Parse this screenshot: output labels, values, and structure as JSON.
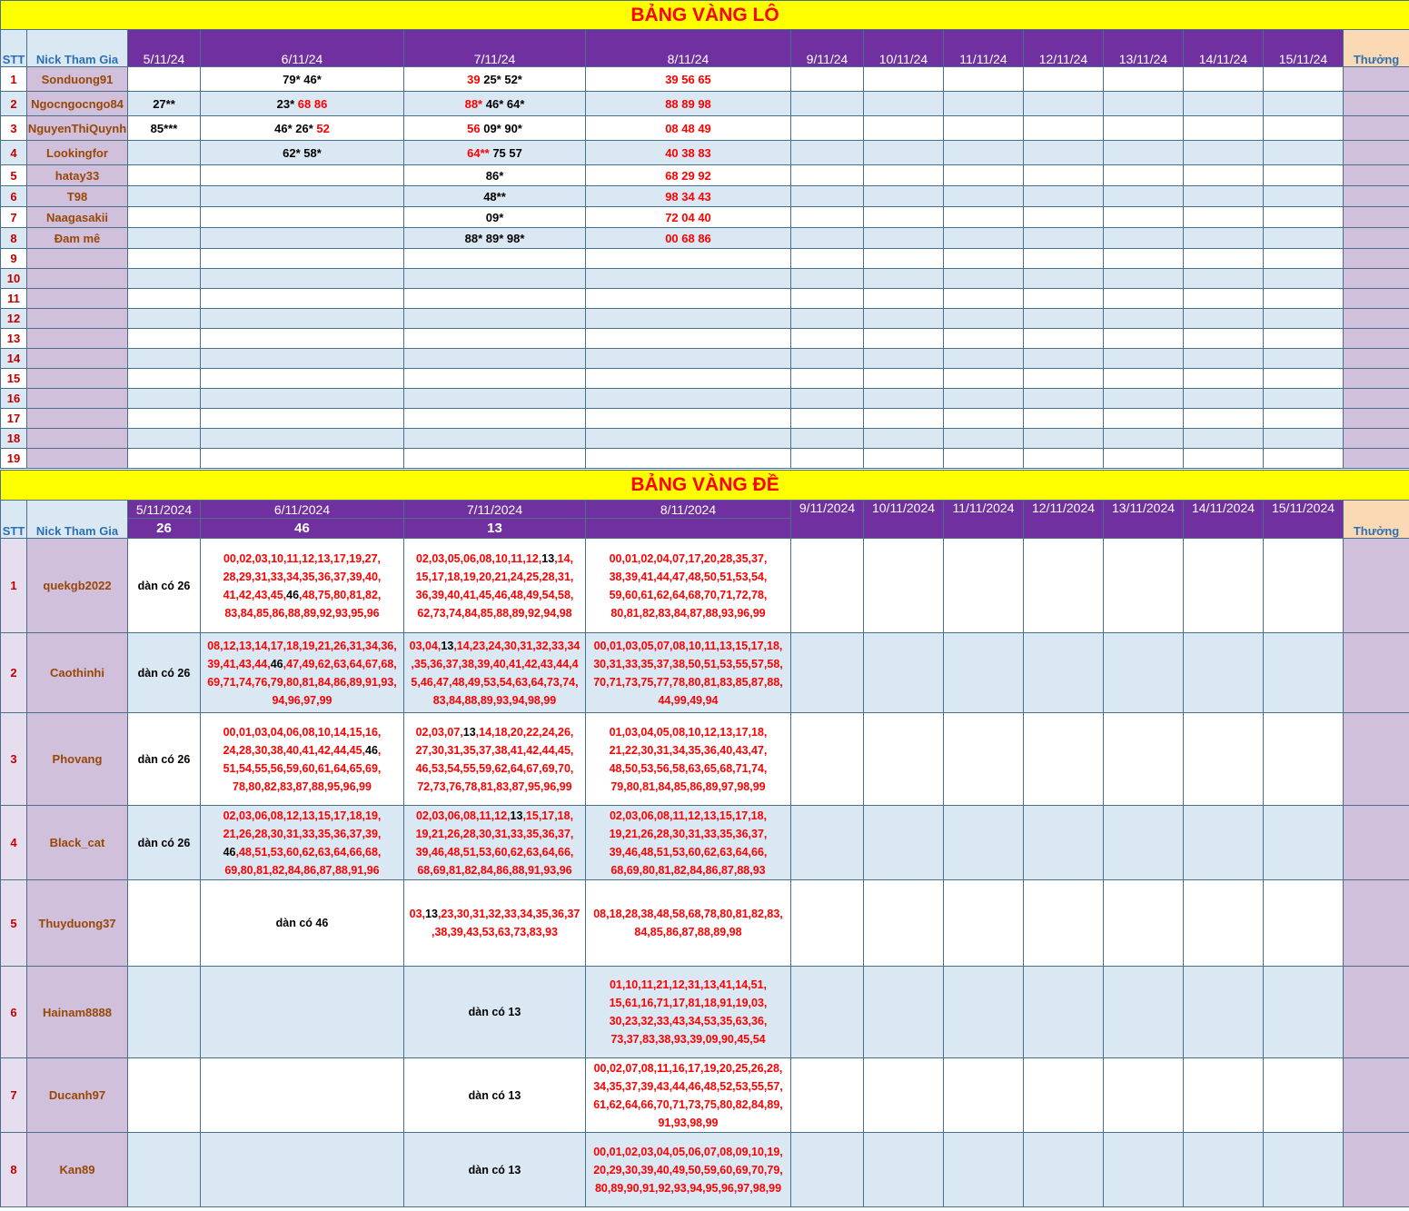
{
  "lo": {
    "title": "BẢNG VÀNG LÔ",
    "headers": {
      "stt": "STT",
      "nick": "Nick Tham Gia",
      "thuong": "Thưởng"
    },
    "dates": [
      "5/11/24",
      "6/11/24",
      "7/11/24",
      "8/11/24",
      "9/11/24",
      "10/11/24",
      "11/11/24",
      "12/11/24",
      "13/11/24",
      "14/11/24",
      "15/11/24"
    ],
    "rows": [
      {
        "stt": "1",
        "nick": "Sonduong91",
        "d1": "",
        "d2": "79* 46*",
        "d3": "39",
        "d3b": "25* 52*",
        "d4": "39 56 65"
      },
      {
        "stt": "2",
        "nick": "Ngocngocngo84",
        "d1": "27**",
        "d2": "23*",
        "d2b": "68 86",
        "d3": "88*",
        "d3b": "46* 64*",
        "d4": "88 89 98"
      },
      {
        "stt": "3",
        "nick": "NguyenThiQuynh",
        "d1": "85***",
        "d2": "46* 26*",
        "d2b": "52",
        "d3": "56",
        "d3b": "09* 90*",
        "d4": "08 48 49"
      },
      {
        "stt": "4",
        "nick": "Lookingfor",
        "d1": "",
        "d2": "62* 58*",
        "d3": "64**",
        "d3b": "75 57",
        "d4": "40 38 83"
      },
      {
        "stt": "5",
        "nick": "hatay33",
        "d1": "",
        "d2": "",
        "d3": "86*",
        "d4": "68 29 92"
      },
      {
        "stt": "6",
        "nick": "T98",
        "d1": "",
        "d2": "",
        "d3": "48**",
        "d4": "98 34 43"
      },
      {
        "stt": "7",
        "nick": "Naagasakii",
        "d1": "",
        "d2": "",
        "d3": "09*",
        "d4": "72 04 40"
      },
      {
        "stt": "8",
        "nick": "Đam mê",
        "d1": "",
        "d2": "",
        "d3": "88* 89* 98*",
        "d4": "00 68 86"
      }
    ],
    "empty_stt": [
      "9",
      "10",
      "11",
      "12",
      "13",
      "14",
      "15",
      "16",
      "17",
      "18",
      "19"
    ]
  },
  "de": {
    "title": "BẢNG VÀNG ĐỀ",
    "headers": {
      "stt": "STT",
      "nick": "Nick Tham Gia",
      "thuong": "Thưởng"
    },
    "dates": [
      "5/11/2024",
      "6/11/2024",
      "7/11/2024",
      "8/11/2024",
      "9/11/2024",
      "10/11/2024",
      "11/11/2024",
      "12/11/2024",
      "13/11/2024",
      "14/11/2024",
      "15/11/2024"
    ],
    "results": [
      "26",
      "46",
      "13"
    ],
    "rows": [
      {
        "stt": "1",
        "nick": "quekgb2022",
        "d1": "dàn có 26",
        "d2a": "00,02,03,10,11,12,13,17,19,27, 28,29,31,33,34,35,36,37,39,40, 41,42,43,45,",
        "d2b": "46",
        "d2c": ",48,75,80,81,82, 83,84,85,86,88,89,92,93,95,96",
        "d3a": "02,03,05,06,08,10,11,12,",
        "d3b": "13",
        "d3c": ",14, 15,17,18,19,20,21,24,25,28,31, 36,39,40,41,45,46,48,49,54,58, 62,73,74,84,85,88,89,92,94,98",
        "d4": "00,01,02,04,07,17,20,28,35,37, 38,39,41,44,47,48,50,51,53,54, 59,60,61,62,64,68,70,71,72,78, 80,81,82,83,84,87,88,93,96,99"
      },
      {
        "stt": "2",
        "nick": "Caothinhi",
        "d1": "dàn có 26",
        "d2a": "08,12,13,14,17,18,19,21,26,31,34,36, 39,41,43,44,",
        "d2b": "46",
        "d2c": ",47,49,62,63,64,67,68, 69,71,74,76,79,80,81,84,86,89,91,93, 94,96,97,99",
        "d3a": "03,04,",
        "d3b": "13",
        "d3c": ",14,23,24,30,31,32,33,34 ,35,36,37,38,39,40,41,42,43,44,4 5,46,47,48,49,53,54,63,64,73,74, 83,84,88,89,93,94,98,99",
        "d4": "00,01,03,05,07,08,10,11,13,15,17,18, 30,31,33,35,37,38,50,51,53,55,57,58, 70,71,73,75,77,78,80,81,83,85,87,88, 44,99,49,94"
      },
      {
        "stt": "3",
        "nick": "Phovang",
        "d1": "dàn có 26",
        "d2a": "00,01,03,04,06,08,10,14,15,16, 24,28,30,38,40,41,42,44,45,",
        "d2b": "46",
        "d2c": ", 51,54,55,56,59,60,61,64,65,69, 78,80,82,83,87,88,95,96,99",
        "d3a": "02,03,07,",
        "d3b": "13",
        "d3c": ",14,18,20,22,24,26, 27,30,31,35,37,38,41,42,44,45, 46,53,54,55,59,62,64,67,69,70, 72,73,76,78,81,83,87,95,96,99",
        "d4": "01,03,04,05,08,10,12,13,17,18, 21,22,30,31,34,35,36,40,43,47, 48,50,53,56,58,63,65,68,71,74, 79,80,81,84,85,86,89,97,98,99"
      },
      {
        "stt": "4",
        "nick": "Black_cat",
        "d1": "dàn có 26",
        "d2a": "02,03,06,08,12,13,15,17,18,19, 21,26,28,30,31,33,35,36,37,39, ",
        "d2b": "46",
        "d2c": ",48,51,53,60,62,63,64,66,68, 69,80,81,82,84,86,87,88,91,96",
        "d3a": "02,03,06,08,11,12,",
        "d3b": "13",
        "d3c": ",15,17,18, 19,21,26,28,30,31,33,35,36,37, 39,46,48,51,53,60,62,63,64,66, 68,69,81,82,84,86,88,91,93,96",
        "d4": "02,03,06,08,11,12,13,15,17,18, 19,21,26,28,30,31,33,35,36,37, 39,46,48,51,53,60,62,63,64,66, 68,69,80,81,82,84,86,87,88,93"
      },
      {
        "stt": "5",
        "nick": "Thuyduong37",
        "d1": "",
        "d2a": "",
        "d2b": "dàn có 46",
        "d2c": "",
        "d3a": "03,",
        "d3b": "13",
        "d3c": ",23,30,31,32,33,34,35,36,37 ,38,39,43,53,63,73,83,93",
        "d4": "08,18,28,38,48,58,68,78,80,81,82,83, 84,85,86,87,88,89,98"
      },
      {
        "stt": "6",
        "nick": "Hainam8888",
        "d1": "",
        "d2a": "",
        "d2b": "",
        "d2c": "",
        "d3a": "",
        "d3b": "dàn có 13",
        "d3c": "",
        "d4": "01,10,11,21,12,31,13,41,14,51, 15,61,16,71,17,81,18,91,19,03, 30,23,32,33,43,34,53,35,63,36, 73,37,83,38,93,39,09,90,45,54"
      },
      {
        "stt": "7",
        "nick": "Ducanh97",
        "d1": "",
        "d2a": "",
        "d2b": "",
        "d2c": "",
        "d3a": "",
        "d3b": "dàn có 13",
        "d3c": "",
        "d4": "00,02,07,08,11,16,17,19,20,25,26,28, 34,35,37,39,43,44,46,48,52,53,55,57, 61,62,64,66,70,71,73,75,80,82,84,89, 91,93,98,99"
      },
      {
        "stt": "8",
        "nick": "Kan89",
        "d1": "",
        "d2a": "",
        "d2b": "",
        "d2c": "",
        "d3a": "",
        "d3b": "dàn có 13",
        "d3c": "",
        "d4": "00,01,02,03,04,05,06,07,08,09,10,19, 20,29,30,39,40,49,50,59,60,69,70,79, 80,89,90,91,92,93,94,95,96,97,98,99"
      }
    ]
  }
}
